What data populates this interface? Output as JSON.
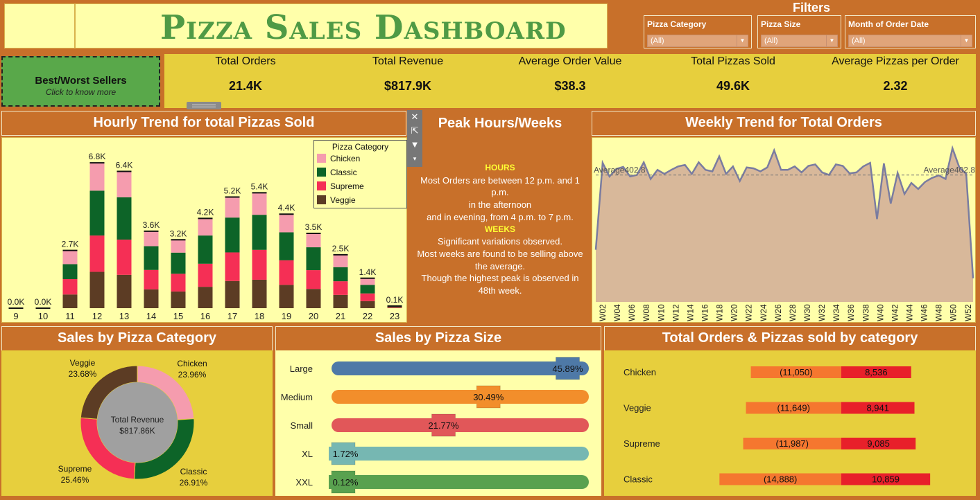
{
  "header": {
    "title": "Pizza Sales Dashboard"
  },
  "filters": {
    "title": "Filters",
    "items": [
      {
        "label": "Pizza Category",
        "value": "(All)"
      },
      {
        "label": "Pizza Size",
        "value": "(All)"
      },
      {
        "label": "Month of Order Date",
        "value": "(All)"
      }
    ]
  },
  "best_worst": {
    "label": "Best/Worst Sellers",
    "sub": "Click to know more"
  },
  "kpis": [
    {
      "label": "Total Orders",
      "value": "21.4K"
    },
    {
      "label": "Total Revenue",
      "value": "$817.9K"
    },
    {
      "label": "Average Order Value",
      "value": "$38.3"
    },
    {
      "label": "Total Pizzas Sold",
      "value": "49.6K"
    },
    {
      "label": "Average Pizzas per Order",
      "value": "2.32"
    }
  ],
  "toolbar": {
    "close_icon": "close-icon",
    "popout_icon": "popout-icon",
    "filter_icon": "filter-icon",
    "menu_icon": "dropdown-icon"
  },
  "peak": {
    "title": "Peak Hours/Weeks",
    "hours_label": "HOURS",
    "hours_lines": [
      "Most Orders are between 12 p.m. and 1",
      "p.m.",
      "in the afternoon",
      "and in evening, from 4 p.m. to 7 p.m."
    ],
    "weeks_label": "WEEKS",
    "weeks_lines": [
      "Significant variations observed.",
      "Most weeks are found to be selling above",
      "the average.",
      "Though the highest peak is observed in",
      "48th week."
    ]
  },
  "sections": {
    "hourly": "Hourly Trend for total Pizzas Sold",
    "weekly": "Weekly Trend for Total Orders",
    "category": "Sales by Pizza Category",
    "size": "Sales by Pizza Size",
    "orders_by_cat": "Total Orders & Pizzas sold by category"
  },
  "colors": {
    "chicken": "#f59cae",
    "classic": "#0d6428",
    "supreme": "#f52f55",
    "veggie": "#5c3c24"
  },
  "chart_data": [
    {
      "type": "bar",
      "stacked": true,
      "legend_title": "Pizza Category",
      "legend": "top-right",
      "categories": [
        "9",
        "10",
        "11",
        "12",
        "13",
        "14",
        "15",
        "16",
        "17",
        "18",
        "19",
        "20",
        "21",
        "22",
        "23"
      ],
      "totals_labels": [
        "0.0K",
        "0.0K",
        "2.7K",
        "6.8K",
        "6.4K",
        "3.6K",
        "3.2K",
        "4.2K",
        "5.2K",
        "5.4K",
        "4.4K",
        "3.5K",
        "2.5K",
        "1.4K",
        "0.1K"
      ],
      "series": [
        {
          "name": "Veggie",
          "values": [
            0,
            0,
            640,
            1700,
            1560,
            880,
            780,
            1000,
            1270,
            1330,
            1090,
            900,
            620,
            330,
            20
          ]
        },
        {
          "name": "Supreme",
          "values": [
            0,
            0,
            720,
            1700,
            1650,
            910,
            830,
            1080,
            1340,
            1400,
            1150,
            880,
            640,
            360,
            30
          ]
        },
        {
          "name": "Classic",
          "values": [
            0,
            0,
            700,
            2100,
            1980,
            1110,
            990,
            1320,
            1630,
            1640,
            1310,
            1070,
            660,
            400,
            30
          ]
        },
        {
          "name": "Chicken",
          "values": [
            0,
            0,
            640,
            1300,
            1210,
            700,
            600,
            800,
            960,
            1030,
            850,
            650,
            580,
            310,
            20
          ]
        }
      ],
      "ylim": [
        0,
        7000
      ]
    },
    {
      "type": "area",
      "x": [
        "W01",
        "W02",
        "W03",
        "W04",
        "W05",
        "W06",
        "W07",
        "W08",
        "W09",
        "W10",
        "W11",
        "W12",
        "W13",
        "W14",
        "W15",
        "W16",
        "W17",
        "W18",
        "W19",
        "W20",
        "W21",
        "W22",
        "W23",
        "W24",
        "W25",
        "W26",
        "W27",
        "W28",
        "W29",
        "W30",
        "W31",
        "W32",
        "W33",
        "W34",
        "W35",
        "W36",
        "W37",
        "W38",
        "W39",
        "W40",
        "W41",
        "W42",
        "W43",
        "W44",
        "W45",
        "W46",
        "W47",
        "W48",
        "W49",
        "W50",
        "W51",
        "W52",
        "W53"
      ],
      "tick_labels": [
        "W02",
        "W04",
        "W06",
        "W08",
        "W10",
        "W12",
        "W14",
        "W16",
        "W18",
        "W20",
        "W22",
        "W24",
        "W26",
        "W28",
        "W30",
        "W32",
        "W34",
        "W36",
        "W38",
        "W40",
        "W42",
        "W44",
        "W46",
        "W48",
        "W50",
        "W52"
      ],
      "values": [
        254,
        427,
        400,
        415,
        419,
        400,
        403,
        428,
        395,
        413,
        405,
        413,
        420,
        423,
        405,
        428,
        413,
        410,
        440,
        405,
        420,
        391,
        418,
        416,
        410,
        418,
        452,
        413,
        413,
        420,
        408,
        421,
        424,
        408,
        403,
        424,
        421,
        406,
        408,
        420,
        427,
        315,
        426,
        346,
        407,
        365,
        387,
        375,
        389,
        397,
        402,
        395,
        456,
        418,
        405,
        197
      ],
      "average": 402.8,
      "average_label": "Average402.8",
      "ylim": [
        150,
        470
      ]
    },
    {
      "type": "pie",
      "donut": true,
      "center_label": "Total Revenue",
      "center_value": "$817.86K",
      "slices": [
        {
          "name": "Chicken",
          "value": 23.96,
          "label": "23.96%"
        },
        {
          "name": "Classic",
          "value": 26.91,
          "label": "26.91%"
        },
        {
          "name": "Supreme",
          "value": 25.46,
          "label": "25.46%"
        },
        {
          "name": "Veggie",
          "value": 23.68,
          "label": "23.68%"
        }
      ]
    },
    {
      "type": "bar",
      "orientation": "horizontal",
      "categories": [
        "Large",
        "Medium",
        "Small",
        "XL",
        "XXL"
      ],
      "values": [
        45.89,
        30.49,
        21.77,
        1.72,
        0.12
      ],
      "labels": [
        "45.89%",
        "30.49%",
        "21.77%",
        "1.72%",
        "0.12%"
      ],
      "colors": [
        "#4e79a7",
        "#f28e2b",
        "#e15759",
        "#76b7b2",
        "#59a14f"
      ],
      "xlim": [
        0,
        50
      ]
    },
    {
      "type": "bar",
      "orientation": "horizontal",
      "diverging": true,
      "categories": [
        "Chicken",
        "Veggie",
        "Supreme",
        "Classic"
      ],
      "series": [
        {
          "values": [
            11050,
            11649,
            11987,
            14888
          ],
          "labels": [
            "(11,050)",
            "(11,649)",
            "(11,987)",
            "(14,888)"
          ]
        },
        {
          "values": [
            8536,
            8941,
            9085,
            10859
          ],
          "labels": [
            "8,536",
            "8,941",
            "9,085",
            "10,859"
          ]
        }
      ]
    }
  ]
}
